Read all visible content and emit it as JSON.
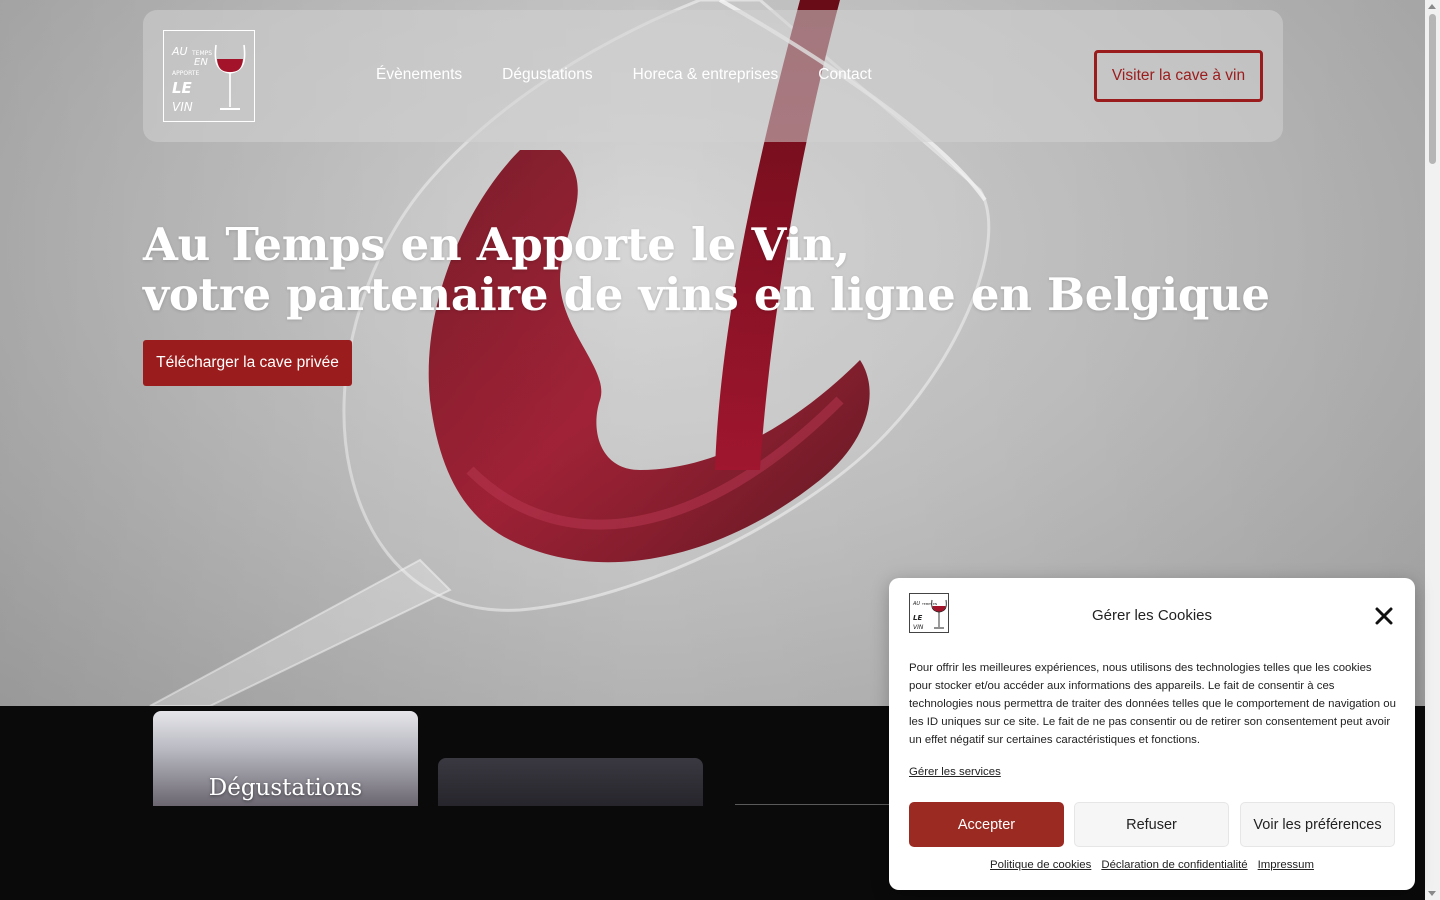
{
  "header": {
    "logo_alt": "Au Temps en Apporte le Vin logo",
    "nav": [
      "Évènements",
      "Dégustations",
      "Horeca & entreprises",
      "Contact"
    ],
    "cta_label": "Visiter la cave à vin"
  },
  "hero": {
    "title_line1": "Au Temps en Apporte le Vin,",
    "title_line2": "votre partenaire de vins en ligne en Belgique",
    "button_label": "Télécharger la cave privée"
  },
  "cards": [
    {
      "title": "Dégustations"
    }
  ],
  "cookie": {
    "title": "Gérer les Cookies",
    "text": "Pour offrir les meilleures expériences, nous utilisons des technologies telles que les cookies pour stocker et/ou accéder aux informations des appareils. Le fait de consentir à ces technologies nous permettra de traiter des données telles que le comportement de navigation ou les ID uniques sur ce site. Le fait de ne pas consentir ou de retirer son consentement peut avoir un effet négatif sur certaines caractéristiques et fonctions.",
    "manage_label": "Gérer les services",
    "accept_label": "Accepter",
    "refuse_label": "Refuser",
    "prefs_label": "Voir les préférences",
    "links": [
      "Politique de cookies",
      "Déclaration de confidentialité",
      "Impressum"
    ]
  },
  "colors": {
    "accent": "#9b1c1c",
    "accept_button": "#9b2a22"
  },
  "icons": {
    "close": "close-icon",
    "wine_glass": "wine-glass-icon"
  }
}
